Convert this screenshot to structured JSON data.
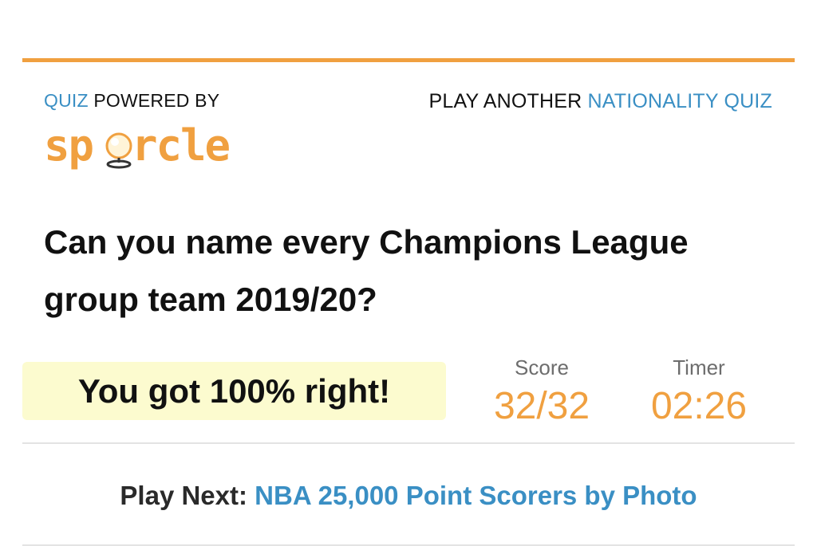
{
  "header": {
    "powered_prefix": "QUIZ",
    "powered_suffix": "POWERED BY",
    "logo_text_left": "sp",
    "logo_text_right": "rcle",
    "play_another_prefix": "PLAY ANOTHER",
    "play_another_link": "NATIONALITY QUIZ"
  },
  "quiz": {
    "title": "Can you name every Champions League group team 2019/20?"
  },
  "result": {
    "message": "You got 100% right!",
    "score_label": "Score",
    "score_value": "32/32",
    "timer_label": "Timer",
    "timer_value": "02:26"
  },
  "next": {
    "prefix": "Play Next:",
    "link": "NBA 25,000 Point Scorers by Photo"
  },
  "colors": {
    "accent_orange": "#f0a040",
    "link_blue": "#3a8fc4",
    "result_highlight": "#fcfbcf"
  }
}
